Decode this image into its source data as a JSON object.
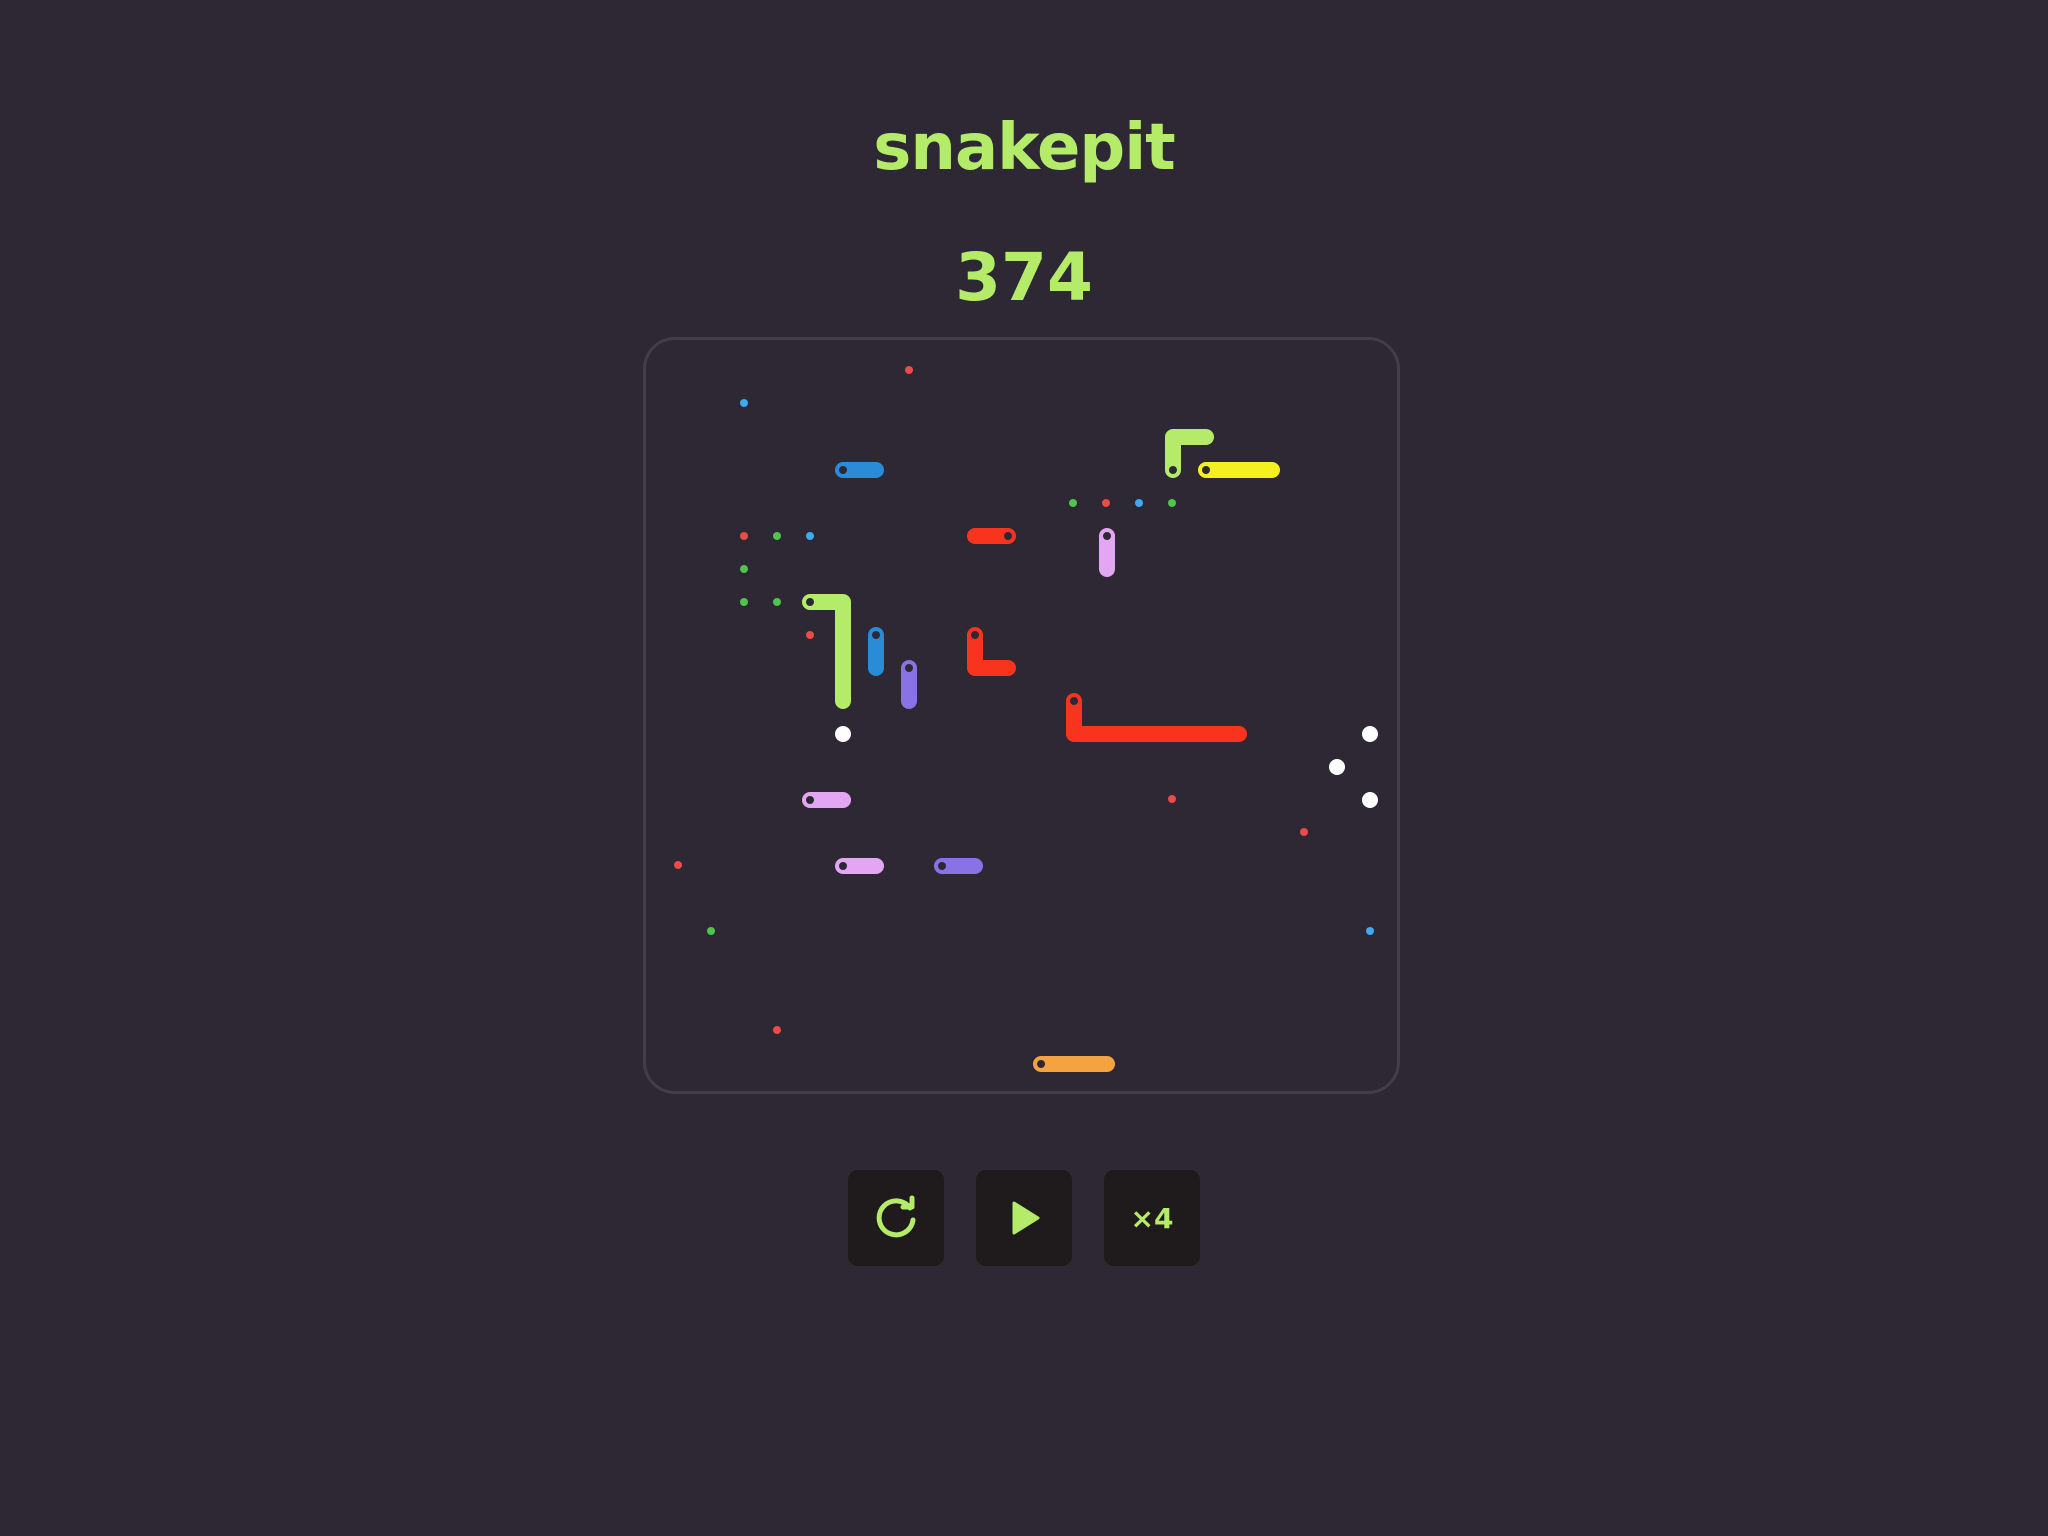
{
  "app": {
    "title": "snakepit"
  },
  "score": {
    "value": "374"
  },
  "colors": {
    "background": "#2d2833",
    "accent": "#b4ec6a",
    "board_border": "#423c4b",
    "button_bg": "#1f1a1c",
    "snake_green": "#b4ec6a",
    "snake_blue": "#2a8bd6",
    "snake_yellow": "#f5f01f",
    "snake_red": "#f8341f",
    "snake_pink": "#e3a6f2",
    "snake_purple": "#8872e6",
    "snake_orange": "#f4a340",
    "food_red": "#ee4a4a",
    "food_green": "#4fc44f",
    "food_blue": "#3fa9f5",
    "food_white": "#ffffff"
  },
  "controls": {
    "restart_icon": "restart-icon",
    "play_icon": "play-icon",
    "speed_label": "×4"
  }
}
